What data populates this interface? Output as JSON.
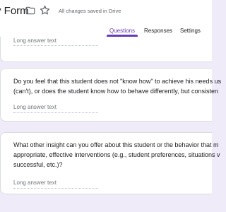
{
  "header": {
    "title": "v Form",
    "saved_status": "All changes saved in Drive",
    "icons": [
      "folder-icon",
      "star-icon"
    ]
  },
  "tabs": [
    {
      "label": "Questions",
      "active": true
    },
    {
      "label": "Responses",
      "active": false
    },
    {
      "label": "Settings",
      "active": false
    }
  ],
  "questions": [
    {
      "lines": [],
      "answer_hint": "Long answer text"
    },
    {
      "lines": [
        "Do you feel that this student does not \"know how\" to achieve his needs us",
        "(can't), or does the student know how to behave differently, but consisten"
      ],
      "answer_hint": "Long answer text"
    },
    {
      "lines": [
        "What other insight can you offer about this student or the behavior that m",
        "appropriate, effective interventions (e.g., student preferences, situations v",
        "successful, etc.)?"
      ],
      "answer_hint": "Long answer text"
    }
  ],
  "colors": {
    "accent": "#673ab7",
    "background": "#f0ebf8"
  }
}
